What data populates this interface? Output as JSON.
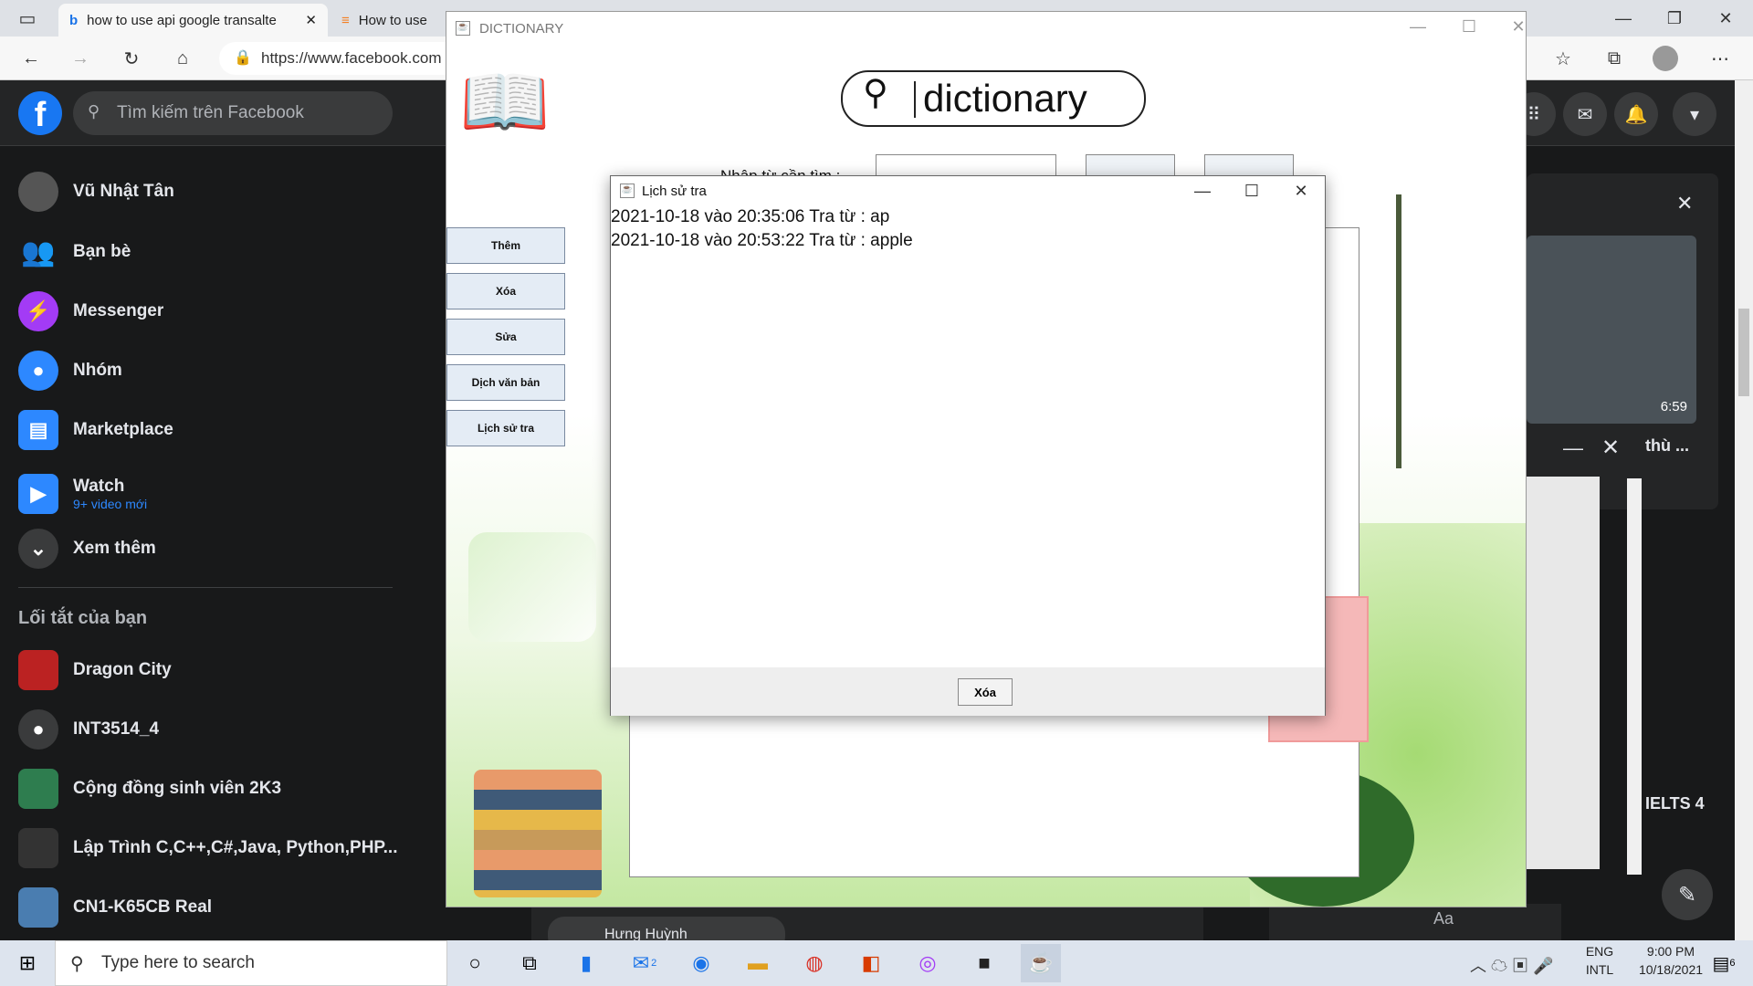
{
  "browser": {
    "tabs": [
      {
        "title": "how to use api google transalte",
        "icon": "bing-icon"
      },
      {
        "title": "How to use G",
        "icon": "stackoverflow-icon"
      }
    ],
    "url": "https://www.facebook.com"
  },
  "facebook": {
    "search_placeholder": "Tìm kiếm trên Facebook",
    "nav": [
      {
        "label": "Vũ Nhật Tân",
        "icon": "avatar"
      },
      {
        "label": "Bạn bè",
        "icon": "friends-icon"
      },
      {
        "label": "Messenger",
        "icon": "messenger-icon"
      },
      {
        "label": "Nhóm",
        "icon": "groups-icon"
      },
      {
        "label": "Marketplace",
        "icon": "marketplace-icon"
      },
      {
        "label": "Watch",
        "sub": "9+ video mới",
        "icon": "watch-icon"
      },
      {
        "label": "Xem thêm",
        "icon": "chevron-down-icon"
      }
    ],
    "shortcuts_title": "Lối tắt của bạn",
    "shortcuts": [
      {
        "label": "Dragon City"
      },
      {
        "label": "INT3514_4"
      },
      {
        "label": "Cộng đồng sinh viên 2K3"
      },
      {
        "label": "Lập Trình C,C++,C#,Java, Python,PHP..."
      },
      {
        "label": "CN1-K65CB Real"
      }
    ],
    "video_time": "6:59",
    "video_title": "thù ...",
    "right_label": "IELTS 4",
    "chat_name": "Hưng Huỳnh",
    "chat_placeholder": "Aa"
  },
  "dictionary_window": {
    "title": "DICTIONARY",
    "logo_text": "dictionary",
    "search_label": "Nhập từ cần tìm :",
    "buttons": [
      "Thêm",
      "Xóa",
      "Sửa",
      "Dịch văn bản",
      "Lịch sử tra"
    ]
  },
  "history_dialog": {
    "title": "Lịch sử tra",
    "entries": [
      "2021-10-18 vào 20:35:06 Tra từ : ap",
      "2021-10-18 vào 20:53:22 Tra từ : apple"
    ],
    "delete_label": "Xóa"
  },
  "taskbar": {
    "search_placeholder": "Type here to search",
    "lang_line1": "ENG",
    "lang_line2": "INTL",
    "time": "9:00 PM",
    "date": "10/18/2021",
    "mail_badge": "2",
    "notif_badge": "6"
  }
}
